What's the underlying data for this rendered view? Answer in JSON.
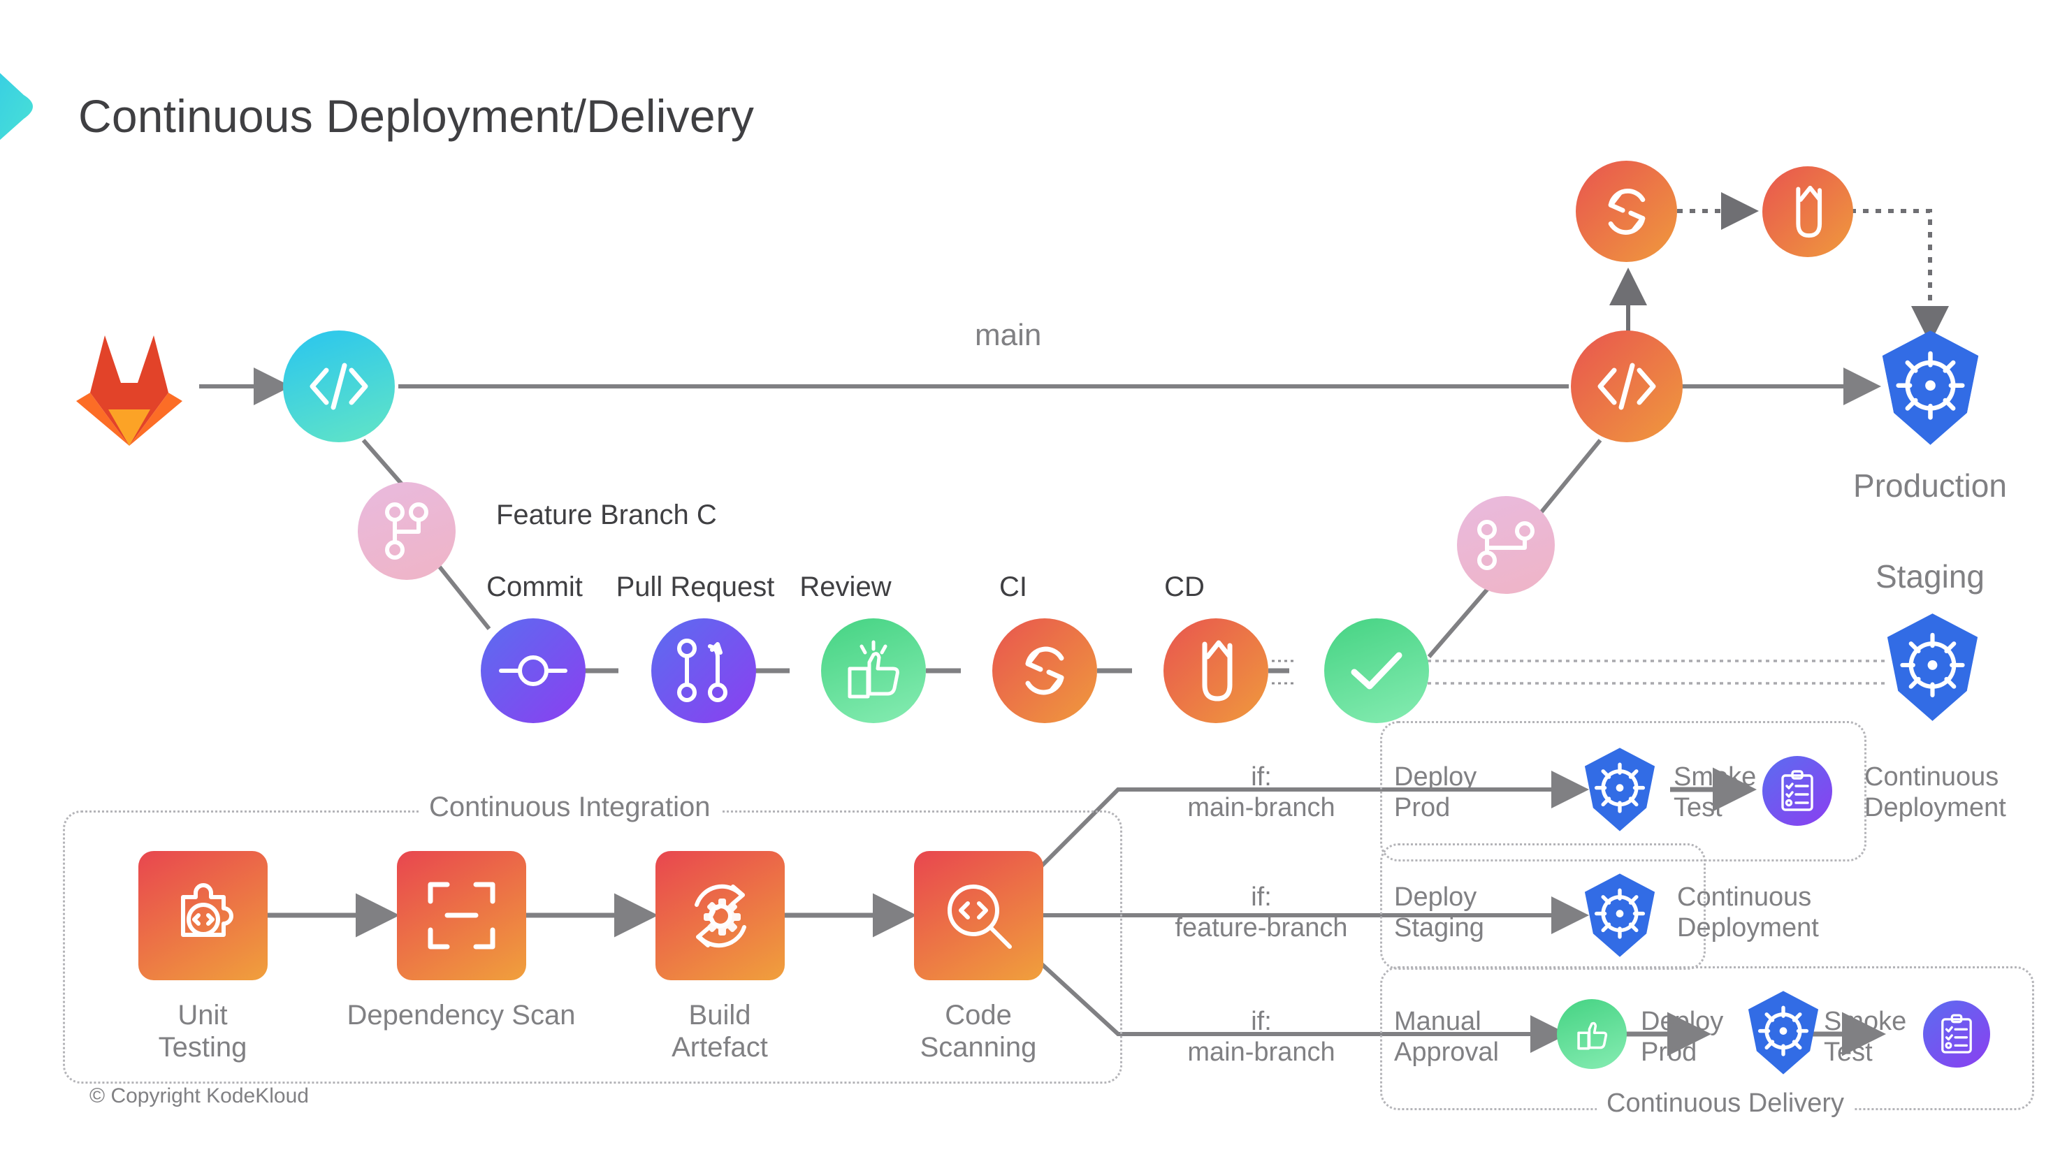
{
  "page": {
    "title": "Continuous Deployment/Delivery",
    "copyright": "© Copyright KodeKloud",
    "background": "#ffffff",
    "text_color": "#808083",
    "title_color": "#3f3f42"
  },
  "colors": {
    "brand_teal_start": "#29c5ef",
    "brand_teal_end": "#4fe6d2",
    "gitlab_dark": "#e24329",
    "gitlab_light": "#fc6d26",
    "repo_cyan_start": "#29c5ef",
    "repo_cyan_end": "#5fe3c8",
    "branch_pink_start": "#e8b8df",
    "branch_pink_end": "#efb6c8",
    "commit_purple_start": "#5b6df0",
    "commit_purple_end": "#8b3ff0",
    "review_green_start": "#4fd98a",
    "review_green_end": "#7fe9ad",
    "ci_orange_start": "#e8554f",
    "ci_orange_end": "#ef9a3d",
    "k8s_blue": "#326ce5",
    "checklist_purple_start": "#5b6df0",
    "checklist_purple_end": "#8b3ff0",
    "edge_gray": "#808083",
    "dotted_gray": "#b4b4b8"
  },
  "top_flow": {
    "gitlab_icon": "gitlab-logo",
    "repo_icon": "code-repo-icon",
    "main_branch_label": "main",
    "feature_branch_label": "Feature Branch C",
    "ci_icon": "continuous-integration-icon",
    "cd_icon": "continuous-deployment-icon",
    "prod_repo_icon": "code-repo-icon",
    "production_label": "Production",
    "staging_label": "Staging",
    "production_icon": "kubernetes-icon",
    "staging_icon": "kubernetes-icon"
  },
  "branch_pipeline": {
    "stages": [
      {
        "label": "Commit",
        "icon": "commit-icon",
        "color_start": "#5b6df0",
        "color_end": "#8b3ff0"
      },
      {
        "label": "Pull Request",
        "icon": "pull-request-icon",
        "color_start": "#5b6df0",
        "color_end": "#8b3ff0"
      },
      {
        "label": "Review",
        "icon": "thumbs-up-icon",
        "color_start": "#4fd98a",
        "color_end": "#7fe9ad"
      },
      {
        "label": "CI",
        "icon": "sync-icon",
        "color_start": "#e8554f",
        "color_end": "#ef9a3d"
      },
      {
        "label": "CD",
        "icon": "deploy-arrow-icon",
        "color_start": "#e8554f",
        "color_end": "#ef9a3d"
      },
      {
        "label": "",
        "icon": "check-circle-icon",
        "color_start": "#4fd98a",
        "color_end": "#7fe9ad"
      }
    ]
  },
  "continuous_integration": {
    "caption": "Continuous Integration",
    "steps": [
      {
        "label_line1": "Unit",
        "label_line2": "Testing",
        "icon": "unit-test-icon"
      },
      {
        "label_line1": "Dependency Scan",
        "label_line2": "",
        "icon": "dependency-scan-icon"
      },
      {
        "label_line1": "Build",
        "label_line2": "Artefact",
        "icon": "build-artefact-icon"
      },
      {
        "label_line1": "Code",
        "label_line2": "Scanning",
        "icon": "code-scanning-icon"
      }
    ]
  },
  "branches": [
    {
      "condition_line1": "if:",
      "condition_line2": "main-branch",
      "box_caption": "",
      "caption_position": "none",
      "steps": [
        {
          "type": "edge-label",
          "line1": "Deploy",
          "line2": "Prod"
        },
        {
          "type": "node",
          "icon": "kubernetes-icon"
        },
        {
          "type": "edge-label",
          "line1": "Smoke",
          "line2": "Test"
        },
        {
          "type": "node",
          "icon": "checklist-icon"
        }
      ],
      "outcome_line1": "Continuous",
      "outcome_line2": "Deployment"
    },
    {
      "condition_line1": "if:",
      "condition_line2": "feature-branch",
      "box_caption": "",
      "caption_position": "none",
      "steps": [
        {
          "type": "edge-label",
          "line1": "Deploy",
          "line2": "Staging"
        },
        {
          "type": "node",
          "icon": "kubernetes-icon"
        }
      ],
      "outcome_line1": "Continuous",
      "outcome_line2": "Deployment"
    },
    {
      "condition_line1": "if:",
      "condition_line2": "main-branch",
      "box_caption": "Continuous Delivery",
      "caption_position": "bottom",
      "steps": [
        {
          "type": "edge-label",
          "line1": "Manual",
          "line2": "Approval"
        },
        {
          "type": "node",
          "icon": "thumbs-up-icon"
        },
        {
          "type": "edge-label",
          "line1": "Deploy",
          "line2": "Prod"
        },
        {
          "type": "node",
          "icon": "kubernetes-icon"
        },
        {
          "type": "edge-label",
          "line1": "Smoke",
          "line2": "Test"
        },
        {
          "type": "node",
          "icon": "checklist-icon"
        }
      ],
      "outcome_line1": "",
      "outcome_line2": ""
    }
  ]
}
